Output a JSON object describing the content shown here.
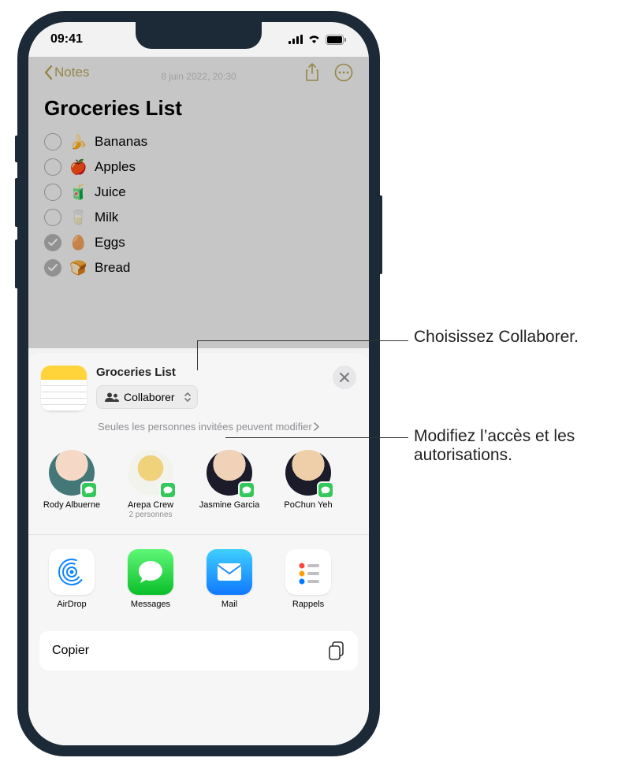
{
  "status": {
    "time": "09:41"
  },
  "nav": {
    "back": "Notes",
    "timestamp": "8 juin 2022, 20:30"
  },
  "note": {
    "title": "Groceries List",
    "items": [
      {
        "emoji": "🍌",
        "label": "Bananas",
        "checked": false
      },
      {
        "emoji": "🍎",
        "label": "Apples",
        "checked": false
      },
      {
        "emoji": "🧃",
        "label": "Juice",
        "checked": false
      },
      {
        "emoji": "🥛",
        "label": "Milk",
        "checked": false
      },
      {
        "emoji": "🥚",
        "label": "Eggs",
        "checked": true
      },
      {
        "emoji": "🍞",
        "label": "Bread",
        "checked": true
      }
    ]
  },
  "sheet": {
    "title": "Groceries List",
    "mode": "Collaborer",
    "permission": "Seules les personnes invitées peuvent modifier",
    "contacts": [
      {
        "name": "Rody Albuerne",
        "sub": ""
      },
      {
        "name": "Arepa Crew",
        "sub": "2 personnes"
      },
      {
        "name": "Jasmine Garcia",
        "sub": ""
      },
      {
        "name": "PoChun Yeh",
        "sub": ""
      }
    ],
    "apps": [
      {
        "name": "AirDrop"
      },
      {
        "name": "Messages"
      },
      {
        "name": "Mail"
      },
      {
        "name": "Rappels"
      }
    ],
    "action": "Copier"
  },
  "callouts": {
    "choose": "Choisissez Collaborer.",
    "modify": "Modifiez l’accès et les autorisations."
  }
}
